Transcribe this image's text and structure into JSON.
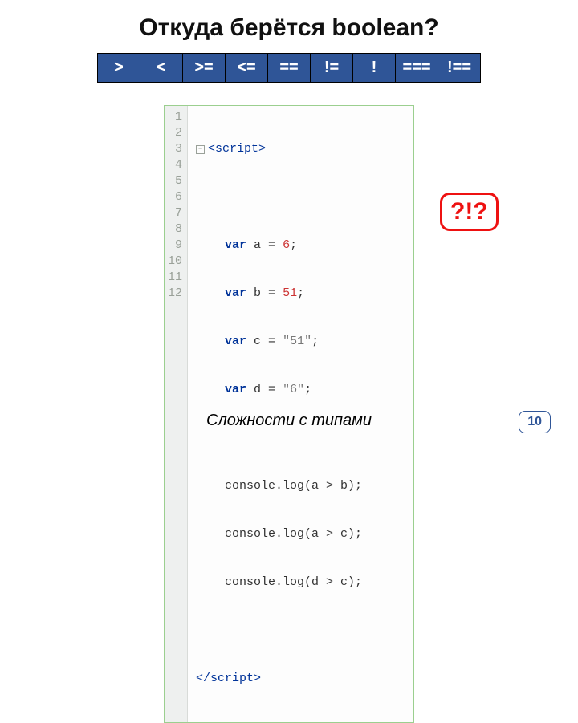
{
  "title": "Откуда берётся boolean?",
  "operators": [
    ">",
    "<",
    ">=",
    "<=",
    "==",
    "!=",
    "!",
    "===",
    "!=="
  ],
  "code_lines_count": 12,
  "code": {
    "l1": {
      "open_tag_angle": "<",
      "open_tag_name": "script",
      "open_tag_end": ">"
    },
    "l3": {
      "kw": "var",
      "rest_a": " a = ",
      "num": "6",
      "semi": ";"
    },
    "l4": {
      "kw": "var",
      "rest_a": " b = ",
      "num": "51",
      "semi": ";"
    },
    "l5": {
      "kw": "var",
      "rest_a": " c = ",
      "str": "\"51\"",
      "semi": ";"
    },
    "l6": {
      "kw": "var",
      "rest_a": " d = ",
      "str": "\"6\"",
      "semi": ";"
    },
    "l8": "console.log(a > b);",
    "l9": "console.log(a > c);",
    "l10": "console.log(d > c);",
    "l12": {
      "close_tag_open": "</",
      "close_tag_name": "script",
      "close_tag_end": ">"
    }
  },
  "bubble": "?!?",
  "footer": "Сложности с типами",
  "page_number": "10"
}
